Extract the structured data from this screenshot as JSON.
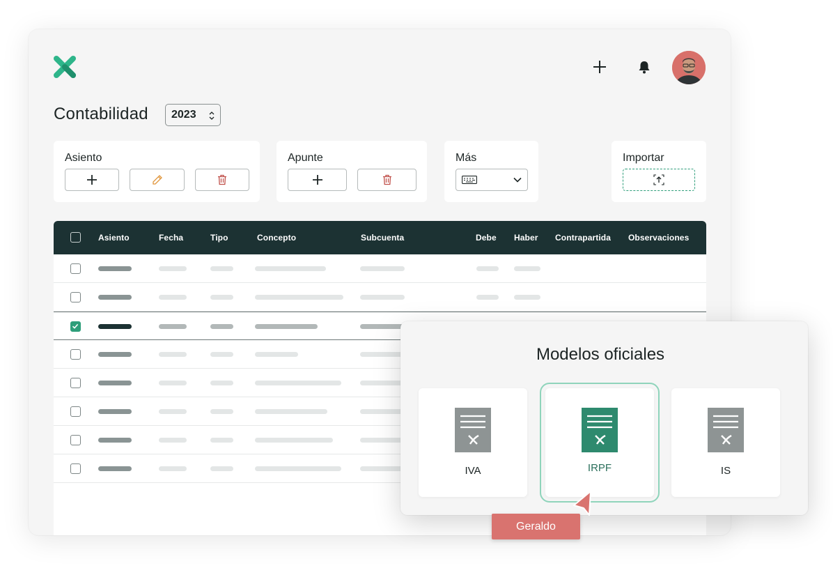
{
  "header": {
    "logo_icon": "x-logo-icon",
    "add_icon": "plus-icon",
    "notifications_icon": "bell-icon",
    "avatar_icon": "user-avatar"
  },
  "page": {
    "title": "Contabilidad",
    "year": "2023"
  },
  "toolbar": {
    "asiento": {
      "title": "Asiento",
      "buttons": [
        "plus-icon",
        "pencil-icon",
        "trash-icon"
      ]
    },
    "apunte": {
      "title": "Apunte",
      "buttons": [
        "plus-icon",
        "trash-icon"
      ]
    },
    "mas": {
      "title": "Más",
      "select_icon": "keyboard-icon"
    },
    "importar": {
      "title": "Importar",
      "button_icon": "upload-icon"
    }
  },
  "table": {
    "columns": [
      "Asiento",
      "Fecha",
      "Tipo",
      "Concepto",
      "Subcuenta",
      "Debe",
      "Haber",
      "Contrapartida",
      "Observaciones"
    ],
    "selected_row_index": 2,
    "row_count": 8
  },
  "modal": {
    "title": "Modelos oficiales",
    "models": [
      {
        "label": "IVA",
        "active": false
      },
      {
        "label": "IRPF",
        "active": true
      },
      {
        "label": "IS",
        "active": false
      }
    ]
  },
  "cursor": {
    "user": "Geraldo"
  },
  "colors": {
    "brand_green": "#2e9e7a",
    "header_dark": "#1c3233",
    "cursor_red": "#d9736f",
    "delete_red": "#c0504a",
    "edit_orange": "#e0953a"
  }
}
